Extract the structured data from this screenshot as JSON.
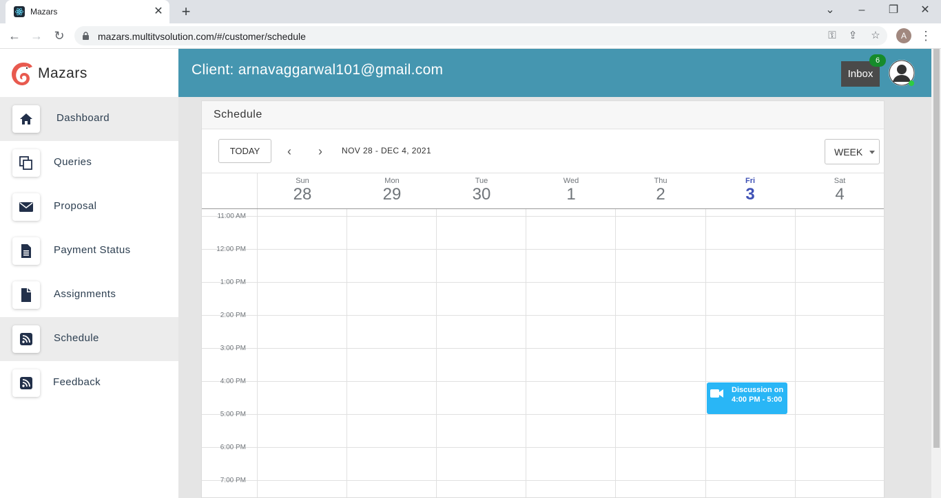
{
  "browser": {
    "tab_title": "Mazars",
    "url": "mazars.multitvsolution.com/#/customer/schedule",
    "profile_initial": "A"
  },
  "sidebar": {
    "brand": "Mazars",
    "items": [
      {
        "label": "Dashboard",
        "icon": "home-icon"
      },
      {
        "label": "Queries",
        "icon": "copy-icon"
      },
      {
        "label": "Proposal",
        "icon": "envelope-icon"
      },
      {
        "label": "Payment Status",
        "icon": "document-icon"
      },
      {
        "label": "Assignments",
        "icon": "file-icon"
      },
      {
        "label": "Schedule",
        "icon": "rss-icon"
      },
      {
        "label": "Feedback",
        "icon": "rss-icon"
      }
    ]
  },
  "header": {
    "client_label": "Client: arnavaggarwal101@gmail.com",
    "inbox_label": "Inbox",
    "inbox_count": "6"
  },
  "schedule": {
    "title": "Schedule",
    "today_label": "TODAY",
    "prev": "‹",
    "next": "›",
    "range": "NOV 28 - DEC 4, 2021",
    "view": "WEEK",
    "days": [
      {
        "dow": "Sun",
        "num": "28"
      },
      {
        "dow": "Mon",
        "num": "29"
      },
      {
        "dow": "Tue",
        "num": "30"
      },
      {
        "dow": "Wed",
        "num": "1"
      },
      {
        "dow": "Thu",
        "num": "2"
      },
      {
        "dow": "Fri",
        "num": "3"
      },
      {
        "dow": "Sat",
        "num": "4"
      }
    ],
    "times": [
      "11:00 AM",
      "12:00 PM",
      "1:00 PM",
      "2:00 PM",
      "3:00 PM",
      "4:00 PM",
      "5:00 PM",
      "6:00 PM",
      "7:00 PM"
    ],
    "event": {
      "title": "Discussion on",
      "time": "4:00 PM  -  5:00"
    }
  },
  "colors": {
    "header_bg": "#4596b0",
    "event_bg": "#29b6f6",
    "today": "#3f51b5",
    "badge": "#168b2b"
  }
}
